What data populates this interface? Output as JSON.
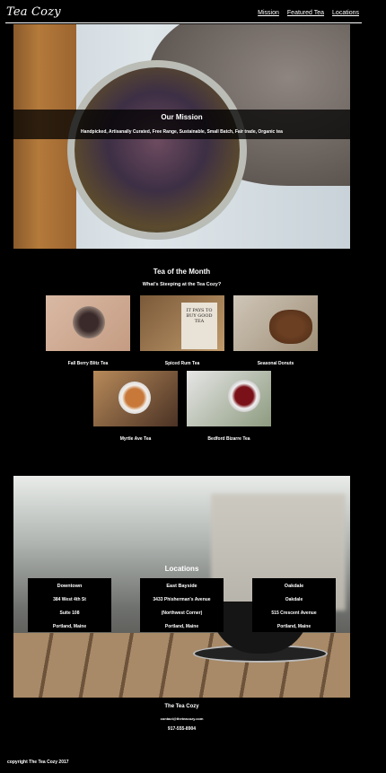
{
  "header": {
    "logo": "Tea Cozy",
    "nav": [
      "Mission",
      "Featured Tea",
      "Locations"
    ]
  },
  "mission": {
    "title": "Our Mission",
    "text": "Handpicked, Artisanally Curated, Free Range, Sustainable, Small Batch, Fair trade, Organic tea"
  },
  "tea_of_month": {
    "title": "Tea of the Month",
    "subtitle": "What's Steeping at the Tea Cozy?",
    "items": [
      {
        "caption": "Fall Berry Blitz Tea"
      },
      {
        "caption": "Spiced Rum Tea"
      },
      {
        "caption": "Seasonal Donuts"
      },
      {
        "caption": "Myrtle Ave Tea"
      },
      {
        "caption": "Bedford Bizarre Tea"
      }
    ]
  },
  "locations": {
    "title": "Locations",
    "stores": [
      {
        "name": "Downtown",
        "lines": [
          "384 West 4th St",
          "Suite 108",
          "Portland, Maine"
        ]
      },
      {
        "name": "East Bayside",
        "lines": [
          "3433 Phisherman's Avenue",
          "(Northwest Corner)",
          "Portland, Maine"
        ]
      },
      {
        "name": "Oakdale",
        "lines": [
          "Oakdale",
          "515 Crescent Avenue",
          "Portland, Maine"
        ]
      }
    ]
  },
  "footer": {
    "name": "The Tea Cozy",
    "email": "contact@theteacozy.com",
    "phone": "917-555-8904",
    "copyright": "copyright The Tea Cozy 2017"
  },
  "colors": {
    "background": "#000000",
    "text": "#ffffff"
  }
}
